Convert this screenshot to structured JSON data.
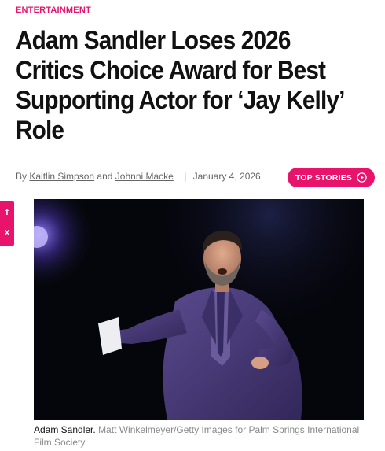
{
  "article": {
    "category": "ENTERTAINMENT",
    "headline": "Adam Sandler Loses 2026 Critics Choice Award for Best Supporting Actor for ‘Jay Kelly’ Role",
    "byline": {
      "prefix": "By",
      "author1": "Kaitlin Simpson",
      "connector": "and",
      "author2": "Johnni Macke",
      "separator": "|",
      "date": "January 4, 2026"
    },
    "top_stories_label": "TOP STORIES",
    "share": {
      "facebook_glyph": "f",
      "x_glyph": "X"
    },
    "photo": {
      "caption_subject": "Adam Sandler.",
      "caption_credit": "Matt Winkelmeyer/Getty Images for Palm Springs International Film Society"
    }
  },
  "colors": {
    "accent": "#e8146c",
    "suit": "#4b3a7a",
    "background": "#05060c"
  },
  "icons": [
    "play-circle-icon",
    "facebook-icon",
    "x-icon"
  ]
}
